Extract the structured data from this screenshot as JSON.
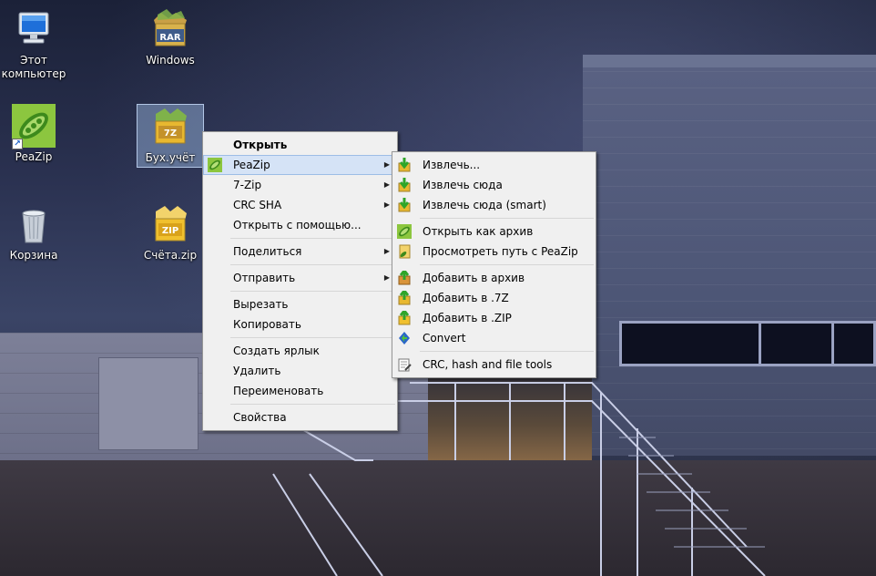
{
  "desktop": {
    "icons": [
      {
        "label": "Этот\nкомпьютер",
        "icon": "computer-icon"
      },
      {
        "label": "Windows",
        "icon": "rar-archive-icon",
        "badge": "RAR"
      },
      {
        "label": "PeaZip",
        "icon": "peazip-icon"
      },
      {
        "label": "Бух.учёт",
        "icon": "7z-archive-icon",
        "badge": "7Z",
        "selected": true
      },
      {
        "label": "Корзина",
        "icon": "recycle-bin-icon"
      },
      {
        "label": "Счёта.zip",
        "icon": "zip-archive-icon",
        "badge": "ZIP"
      }
    ]
  },
  "context_menu": {
    "items": [
      {
        "label": "Открыть",
        "bold": true
      },
      {
        "label": "PeaZip",
        "submenu": true,
        "icon": "peazip-icon",
        "highlighted": true
      },
      {
        "label": "7-Zip",
        "submenu": true
      },
      {
        "label": "CRC SHA",
        "submenu": true
      },
      {
        "label": "Открыть с помощью..."
      },
      {
        "separator": true
      },
      {
        "label": "Поделиться",
        "submenu": true
      },
      {
        "separator": true
      },
      {
        "label": "Отправить",
        "submenu": true
      },
      {
        "separator": true
      },
      {
        "label": "Вырезать"
      },
      {
        "label": "Копировать"
      },
      {
        "separator": true
      },
      {
        "label": "Создать ярлык"
      },
      {
        "label": "Удалить"
      },
      {
        "label": "Переименовать"
      },
      {
        "separator": true
      },
      {
        "label": "Свойства"
      }
    ]
  },
  "peazip_submenu": {
    "items": [
      {
        "label": "Извлечь...",
        "icon": "extract-icon"
      },
      {
        "label": "Извлечь сюда",
        "icon": "extract-icon"
      },
      {
        "label": "Извлечь сюда (smart)",
        "icon": "extract-icon"
      },
      {
        "separator": true
      },
      {
        "label": "Открыть как архив",
        "icon": "peazip-icon"
      },
      {
        "label": "Просмотреть путь с PeaZip",
        "icon": "browse-path-icon"
      },
      {
        "separator": true
      },
      {
        "label": "Добавить в архив",
        "icon": "add-archive-icon"
      },
      {
        "label": "Добавить в .7Z",
        "icon": "add-archive-icon"
      },
      {
        "label": "Добавить в .ZIP",
        "icon": "add-archive-icon"
      },
      {
        "label": "Convert",
        "icon": "convert-icon"
      },
      {
        "separator": true
      },
      {
        "label": "CRC, hash and file tools",
        "icon": "hash-tools-icon"
      }
    ]
  },
  "colors": {
    "menu_bg": "#f0f0f0",
    "menu_highlight": "#d5e3f6",
    "archive_folder": "#e8b830",
    "extract_arrow": "#2fa52a",
    "peazip_green": "#6cbf2a"
  }
}
